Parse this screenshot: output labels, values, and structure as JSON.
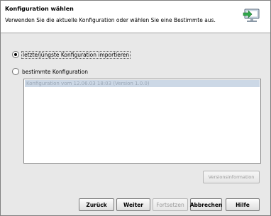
{
  "header": {
    "title": "Konfiguration wählen",
    "description": "Verwenden Sie die aktuelle Konfiguration oder wählen Sie eine Bestimmte aus.",
    "icon": "monitor-import-icon"
  },
  "options": [
    {
      "label": "letzte/jüngste Konfiguration importieren",
      "selected": true
    },
    {
      "label": "bestimmte Konfiguration",
      "selected": false
    }
  ],
  "config_list": {
    "items": [
      "Konfiguration vom 12.06.03 18:03 (Version 1.0.0)"
    ]
  },
  "buttons": {
    "version_info": "Versionsinformation",
    "back": "Zurück",
    "next": "Weiter",
    "continue": "Fortsetzen",
    "cancel": "Abbrechen",
    "help": "Hilfe"
  }
}
